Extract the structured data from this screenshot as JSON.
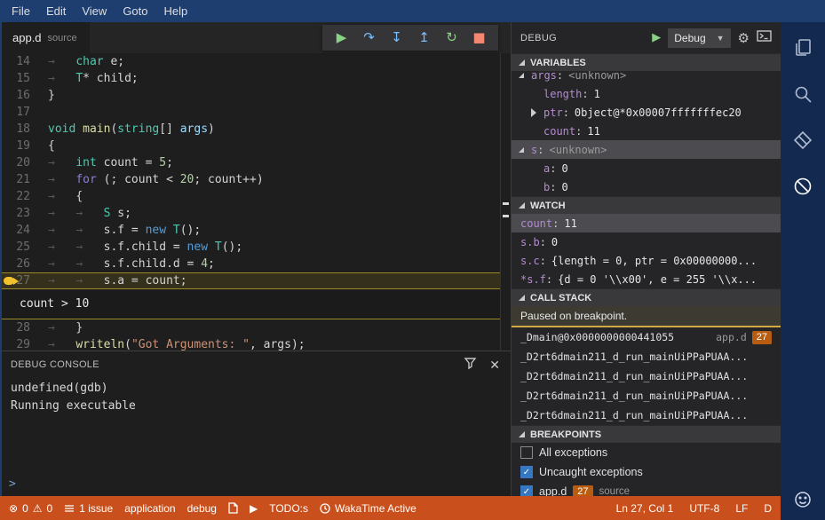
{
  "colors": {
    "menubar_blue": "#1e3e70",
    "activitybar_navy": "#14294f",
    "statusbar_orange": "#c9501c",
    "current_line_yellow": "#9a8a28",
    "breakpoint_yellow": "#f2c12e",
    "badge_orange": "#b85c10",
    "checkbox_blue": "#3577c1",
    "play_green": "#89d185",
    "step_blue": "#75beff",
    "stop_red": "#f48771"
  },
  "menu": {
    "items": [
      "File",
      "Edit",
      "View",
      "Goto",
      "Help"
    ]
  },
  "editor_tab": {
    "name": "app.d",
    "kind": "source"
  },
  "debug_toolbar": {
    "buttons": [
      {
        "name": "continue",
        "glyph": "▶"
      },
      {
        "name": "step-over",
        "glyph": "↷"
      },
      {
        "name": "step-into",
        "glyph": "↧"
      },
      {
        "name": "step-out",
        "glyph": "↥"
      },
      {
        "name": "restart",
        "glyph": "↻"
      },
      {
        "name": "stop",
        "glyph": "■"
      }
    ]
  },
  "editor": {
    "peek": {
      "after_line": 27,
      "text": "count > 10"
    },
    "lines": [
      {
        "num": 14,
        "tokens": [
          [
            "ws",
            "→   "
          ],
          [
            "kw",
            "char"
          ],
          [
            "pl",
            " e;"
          ]
        ]
      },
      {
        "num": 15,
        "tokens": [
          [
            "ws",
            "→   "
          ],
          [
            "kw",
            "T"
          ],
          [
            "pl",
            "* child;"
          ]
        ]
      },
      {
        "num": 16,
        "tokens": [
          [
            "pl",
            "}"
          ]
        ]
      },
      {
        "num": 17,
        "tokens": []
      },
      {
        "num": 18,
        "tokens": [
          [
            "kw",
            "void"
          ],
          [
            "pl",
            " "
          ],
          [
            "fn",
            "main"
          ],
          [
            "pl",
            "("
          ],
          [
            "kw",
            "string"
          ],
          [
            "pl",
            "[] "
          ],
          [
            "param",
            "args"
          ],
          [
            "pl",
            ")"
          ]
        ]
      },
      {
        "num": 19,
        "tokens": [
          [
            "pl",
            "{"
          ]
        ]
      },
      {
        "num": 20,
        "tokens": [
          [
            "ws",
            "→   "
          ],
          [
            "kw",
            "int"
          ],
          [
            "pl",
            " count = "
          ],
          [
            "num",
            "5"
          ],
          [
            "pl",
            ";"
          ]
        ]
      },
      {
        "num": 21,
        "tokens": [
          [
            "ws",
            "→   "
          ],
          [
            "ctrl",
            "for"
          ],
          [
            "pl",
            " (; count < "
          ],
          [
            "num",
            "20"
          ],
          [
            "pl",
            "; count++)"
          ]
        ]
      },
      {
        "num": 22,
        "tokens": [
          [
            "ws",
            "→   "
          ],
          [
            "pl",
            "{"
          ]
        ]
      },
      {
        "num": 23,
        "tokens": [
          [
            "ws",
            "→   "
          ],
          [
            "ws",
            "→   "
          ],
          [
            "kw",
            "S"
          ],
          [
            "pl",
            " s;"
          ]
        ]
      },
      {
        "num": 24,
        "tokens": [
          [
            "ws",
            "→   "
          ],
          [
            "ws",
            "→   "
          ],
          [
            "pl",
            "s.f = "
          ],
          [
            "kw2",
            "new"
          ],
          [
            "pl",
            " "
          ],
          [
            "kw",
            "T"
          ],
          [
            "pl",
            "();"
          ]
        ]
      },
      {
        "num": 25,
        "tokens": [
          [
            "ws",
            "→   "
          ],
          [
            "ws",
            "→   "
          ],
          [
            "pl",
            "s.f.child = "
          ],
          [
            "kw2",
            "new"
          ],
          [
            "pl",
            " "
          ],
          [
            "kw",
            "T"
          ],
          [
            "pl",
            "();"
          ]
        ]
      },
      {
        "num": 26,
        "tokens": [
          [
            "ws",
            "→   "
          ],
          [
            "ws",
            "→   "
          ],
          [
            "pl",
            "s.f.child.d = "
          ],
          [
            "num",
            "4"
          ],
          [
            "pl",
            ";"
          ]
        ]
      },
      {
        "num": 27,
        "current": true,
        "breakpoint": true,
        "tokens": [
          [
            "ws",
            "→   "
          ],
          [
            "ws",
            "→   "
          ],
          [
            "pl",
            "s.a = count;"
          ]
        ]
      },
      {
        "num": 28,
        "tokens": [
          [
            "ws",
            "→   "
          ],
          [
            "pl",
            "}"
          ]
        ]
      },
      {
        "num": 29,
        "tokens": [
          [
            "ws",
            "→   "
          ],
          [
            "fn",
            "writeln"
          ],
          [
            "pl",
            "("
          ],
          [
            "str",
            "\"Got Arguments: \""
          ],
          [
            "pl",
            ", args);"
          ]
        ]
      }
    ]
  },
  "console": {
    "title": "DEBUG CONSOLE",
    "lines": [
      "undefined(gdb)",
      "Running executable"
    ],
    "prompt": ">"
  },
  "sidebar": {
    "title": "DEBUG",
    "config_name": "Debug",
    "variables": {
      "title": "VARIABLES",
      "rows": [
        {
          "name": "args",
          "value": "<unknown>",
          "indent": 0,
          "twisty": "open",
          "clipped": true
        },
        {
          "name": "length",
          "value": "1",
          "indent": 1
        },
        {
          "name": "ptr",
          "value": "0bject@*0x00007fffffffec20",
          "indent": 1,
          "twisty": "closed"
        },
        {
          "name": "count",
          "value": "11",
          "indent": 1
        },
        {
          "name": "s",
          "value": "<unknown>",
          "indent": 0,
          "twisty": "open",
          "selected": true
        },
        {
          "name": "a",
          "value": "0",
          "indent": 1
        },
        {
          "name": "b",
          "value": "0",
          "indent": 1
        }
      ]
    },
    "watch": {
      "title": "WATCH",
      "rows": [
        {
          "name": "count",
          "value": "11",
          "selected": true
        },
        {
          "name": "s.b",
          "value": "0"
        },
        {
          "name": "s.c",
          "value": "{length = 0, ptr = 0x00000000..."
        },
        {
          "name": "*s.f",
          "value": "{d = 0 '\\\\x00', e = 255 '\\\\x..."
        }
      ]
    },
    "call_stack": {
      "title": "CALL STACK",
      "status": "Paused on breakpoint.",
      "frames": [
        {
          "label": "_Dmain@0x0000000000441055",
          "file": "app.d",
          "line": "27"
        },
        {
          "label": "_D2rt6dmain211_d_run_mainUiPPaPUAA..."
        },
        {
          "label": "_D2rt6dmain211_d_run_mainUiPPaPUAA..."
        },
        {
          "label": "_D2rt6dmain211_d_run_mainUiPPaPUAA..."
        },
        {
          "label": "_D2rt6dmain211_d_run_mainUiPPaPUAA..."
        }
      ]
    },
    "breakpoints": {
      "title": "BREAKPOINTS",
      "items": [
        {
          "label": "All exceptions",
          "checked": false
        },
        {
          "label": "Uncaught exceptions",
          "checked": true
        },
        {
          "label": "app.d",
          "checked": true,
          "line": "27",
          "suffix": "source"
        }
      ]
    }
  },
  "status_bar": {
    "errors": "0",
    "warnings": "0",
    "issues": "1 issue",
    "mode": "application",
    "target": "debug",
    "todos": "TODO:s",
    "wakatime": "WakaTime Active",
    "line_col": "Ln 27, Col 1",
    "encoding": "UTF-8",
    "eol": "LF",
    "language": "D"
  }
}
